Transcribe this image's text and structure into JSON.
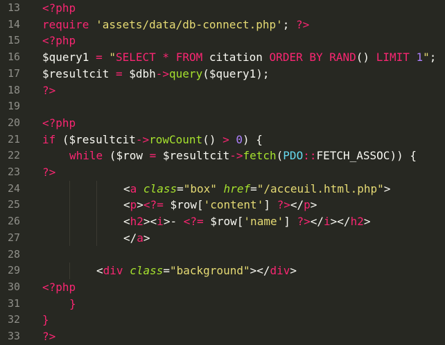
{
  "editor": {
    "colors": {
      "background": "#272822",
      "foreground": "#f8f8f2",
      "keyword": "#f92672",
      "string": "#e6db74",
      "function": "#a6e22e",
      "number": "#ae81ff",
      "constant": "#66d9ef",
      "gutter_text": "#90908a"
    },
    "lines": [
      {
        "n": "13",
        "indent": 0,
        "tokens": [
          {
            "t": "<?php",
            "c": "kw"
          }
        ]
      },
      {
        "n": "14",
        "indent": 0,
        "tokens": [
          {
            "t": "require ",
            "c": "kw"
          },
          {
            "t": "'assets/data/db-connect.php'",
            "c": "st"
          },
          {
            "t": "; ",
            "c": "tx"
          },
          {
            "t": "?>",
            "c": "kw"
          }
        ]
      },
      {
        "n": "15",
        "indent": 0,
        "tokens": [
          {
            "t": "<?php",
            "c": "kw"
          }
        ]
      },
      {
        "n": "16",
        "indent": 0,
        "tokens": [
          {
            "t": "$query1 ",
            "c": "tx"
          },
          {
            "t": "= ",
            "c": "kw"
          },
          {
            "t": "\"",
            "c": "st"
          },
          {
            "t": "SELECT",
            "c": "kw"
          },
          {
            "t": " ",
            "c": "st"
          },
          {
            "t": "*",
            "c": "kw"
          },
          {
            "t": " ",
            "c": "st"
          },
          {
            "t": "FROM",
            "c": "kw"
          },
          {
            "t": " citation ",
            "c": "tx"
          },
          {
            "t": "ORDER BY",
            "c": "kw"
          },
          {
            "t": " ",
            "c": "st"
          },
          {
            "t": "RAND",
            "c": "kw"
          },
          {
            "t": "() ",
            "c": "tx"
          },
          {
            "t": "LIMIT",
            "c": "kw"
          },
          {
            "t": " ",
            "c": "st"
          },
          {
            "t": "1",
            "c": "nu"
          },
          {
            "t": "\"",
            "c": "st"
          },
          {
            "t": ";",
            "c": "tx"
          }
        ]
      },
      {
        "n": "17",
        "indent": 0,
        "tokens": [
          {
            "t": "$resultcit ",
            "c": "tx"
          },
          {
            "t": "= ",
            "c": "kw"
          },
          {
            "t": "$dbh",
            "c": "tx"
          },
          {
            "t": "->",
            "c": "kw"
          },
          {
            "t": "query",
            "c": "fn"
          },
          {
            "t": "($query1);",
            "c": "tx"
          }
        ]
      },
      {
        "n": "18",
        "indent": 0,
        "tokens": [
          {
            "t": "?>",
            "c": "kw"
          }
        ]
      },
      {
        "n": "19",
        "indent": 0,
        "tokens": []
      },
      {
        "n": "20",
        "indent": 0,
        "tokens": [
          {
            "t": "<?php",
            "c": "kw"
          }
        ]
      },
      {
        "n": "21",
        "indent": 0,
        "tokens": [
          {
            "t": "if",
            "c": "kw"
          },
          {
            "t": " ($resultcit",
            "c": "tx"
          },
          {
            "t": "->",
            "c": "kw"
          },
          {
            "t": "rowCount",
            "c": "fn"
          },
          {
            "t": "() ",
            "c": "tx"
          },
          {
            "t": ">",
            "c": "kw"
          },
          {
            "t": " ",
            "c": "tx"
          },
          {
            "t": "0",
            "c": "nu"
          },
          {
            "t": ") {",
            "c": "tx"
          }
        ]
      },
      {
        "n": "22",
        "indent": 1,
        "tokens": [
          {
            "t": "while",
            "c": "kw"
          },
          {
            "t": " ($row ",
            "c": "tx"
          },
          {
            "t": "=",
            "c": "kw"
          },
          {
            "t": " $resultcit",
            "c": "tx"
          },
          {
            "t": "->",
            "c": "kw"
          },
          {
            "t": "fetch",
            "c": "fn"
          },
          {
            "t": "(",
            "c": "tx"
          },
          {
            "t": "PDO",
            "c": "ct"
          },
          {
            "t": "::",
            "c": "kw"
          },
          {
            "t": "FETCH_ASSOC",
            "c": "tx"
          },
          {
            "t": ")) {",
            "c": "tx"
          }
        ]
      },
      {
        "n": "23",
        "indent": 0,
        "tokens": [
          {
            "t": "?>",
            "c": "kw"
          }
        ]
      },
      {
        "n": "24",
        "indent": 3,
        "tokens": [
          {
            "t": "<",
            "c": "tx"
          },
          {
            "t": "a",
            "c": "kw"
          },
          {
            "t": " ",
            "c": "tx"
          },
          {
            "t": "class",
            "c": "at"
          },
          {
            "t": "=",
            "c": "tx"
          },
          {
            "t": "\"box\"",
            "c": "st"
          },
          {
            "t": " ",
            "c": "tx"
          },
          {
            "t": "href",
            "c": "at"
          },
          {
            "t": "=",
            "c": "tx"
          },
          {
            "t": "\"/acceuil.html.php\"",
            "c": "st"
          },
          {
            "t": ">",
            "c": "tx"
          }
        ]
      },
      {
        "n": "25",
        "indent": 3,
        "tokens": [
          {
            "t": "<",
            "c": "tx"
          },
          {
            "t": "p",
            "c": "kw"
          },
          {
            "t": ">",
            "c": "tx"
          },
          {
            "t": "<?=",
            "c": "kw"
          },
          {
            "t": " $row[",
            "c": "tx"
          },
          {
            "t": "'content'",
            "c": "st"
          },
          {
            "t": "] ",
            "c": "tx"
          },
          {
            "t": "?>",
            "c": "kw"
          },
          {
            "t": "</",
            "c": "tx"
          },
          {
            "t": "p",
            "c": "kw"
          },
          {
            "t": ">",
            "c": "tx"
          }
        ]
      },
      {
        "n": "26",
        "indent": 3,
        "tokens": [
          {
            "t": "<",
            "c": "tx"
          },
          {
            "t": "h2",
            "c": "kw"
          },
          {
            "t": "><",
            "c": "tx"
          },
          {
            "t": "i",
            "c": "kw"
          },
          {
            "t": ">- ",
            "c": "tx"
          },
          {
            "t": "<?=",
            "c": "kw"
          },
          {
            "t": " $row[",
            "c": "tx"
          },
          {
            "t": "'name'",
            "c": "st"
          },
          {
            "t": "] ",
            "c": "tx"
          },
          {
            "t": "?>",
            "c": "kw"
          },
          {
            "t": "</",
            "c": "tx"
          },
          {
            "t": "i",
            "c": "kw"
          },
          {
            "t": "></",
            "c": "tx"
          },
          {
            "t": "h2",
            "c": "kw"
          },
          {
            "t": ">",
            "c": "tx"
          }
        ]
      },
      {
        "n": "27",
        "indent": 3,
        "tokens": [
          {
            "t": "</",
            "c": "tx"
          },
          {
            "t": "a",
            "c": "kw"
          },
          {
            "t": ">",
            "c": "tx"
          }
        ]
      },
      {
        "n": "28",
        "indent": 0,
        "tokens": []
      },
      {
        "n": "29",
        "indent": 2,
        "tokens": [
          {
            "t": "<",
            "c": "tx"
          },
          {
            "t": "div",
            "c": "kw"
          },
          {
            "t": " ",
            "c": "tx"
          },
          {
            "t": "class",
            "c": "at"
          },
          {
            "t": "=",
            "c": "tx"
          },
          {
            "t": "\"background\"",
            "c": "st"
          },
          {
            "t": "></",
            "c": "tx"
          },
          {
            "t": "div",
            "c": "kw"
          },
          {
            "t": ">",
            "c": "tx"
          }
        ]
      },
      {
        "n": "30",
        "indent": 0,
        "tokens": [
          {
            "t": "<?php",
            "c": "kw"
          }
        ]
      },
      {
        "n": "31",
        "indent": 1,
        "tokens": [
          {
            "t": "}",
            "c": "kw"
          }
        ]
      },
      {
        "n": "32",
        "indent": 0,
        "tokens": [
          {
            "t": "}",
            "c": "kw"
          }
        ]
      },
      {
        "n": "33",
        "indent": 0,
        "tokens": [
          {
            "t": "?>",
            "c": "kw"
          }
        ]
      }
    ]
  }
}
